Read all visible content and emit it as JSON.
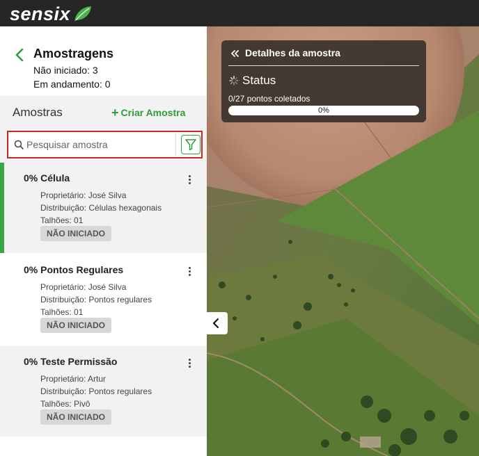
{
  "brand": {
    "name": "sensix",
    "accent": "#2e9e3a",
    "leaf_icon": "leaf-icon"
  },
  "panel": {
    "title": "Amostragens",
    "not_started_line": "Não iniciado: 3",
    "in_progress_line": "Em andamento: 0",
    "samples_label": "Amostras",
    "create_label": "Criar Amostra",
    "search_placeholder": "Pesquisar amostra",
    "search_value": ""
  },
  "samples": [
    {
      "title": "0% Célula",
      "progress": 0,
      "owner": "Proprietário: José Silva",
      "distribution": "Distribuição: Células hexagonais",
      "fields": "Talhões: 01",
      "badge": "NÃO INICIADO",
      "selected": true
    },
    {
      "title": "0% Pontos Regulares",
      "progress": 0,
      "owner": "Proprietário: José Silva",
      "distribution": "Distribuição: Pontos regulares",
      "fields": "Talhões: 01",
      "badge": "NÃO INICIADO",
      "selected": false
    },
    {
      "title": "0% Teste Permissão",
      "progress": 0,
      "owner": "Proprietário: Artur",
      "distribution": "Distribuição: Pontos regulares",
      "fields": "Talhões: Pivô",
      "badge": "NÃO INICIADO",
      "selected": false
    }
  ],
  "details": {
    "title": "Detalhes da amostra",
    "status_label": "Status",
    "points_collected": "0/27 pontos coletados",
    "progress_label": "0%",
    "progress_fraction": 0
  }
}
